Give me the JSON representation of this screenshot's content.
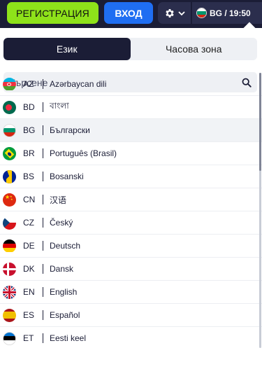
{
  "header": {
    "register_label": "РЕГИСТРАЦИЯ",
    "login_label": "ВХОД",
    "settings_icon": "gear-icon",
    "locale_label": "BG / 19:50"
  },
  "tabs": [
    {
      "label": "Език",
      "active": true
    },
    {
      "label": "Часова зона",
      "active": false
    }
  ],
  "search": {
    "placeholder": "Търсене",
    "icon": "search-icon"
  },
  "languages": [
    {
      "code": "AZ",
      "name": "Azərbaycan dili",
      "flag": "azerbaijan"
    },
    {
      "code": "BD",
      "name": "বাংলা",
      "flag": "bangladesh"
    },
    {
      "code": "BG",
      "name": "Български",
      "flag": "bulgaria",
      "selected": true
    },
    {
      "code": "BR",
      "name": "Português (Brasil)",
      "flag": "brazil"
    },
    {
      "code": "BS",
      "name": "Bosanski",
      "flag": "bosnia"
    },
    {
      "code": "CN",
      "name": "汉语",
      "flag": "china"
    },
    {
      "code": "CZ",
      "name": "Český",
      "flag": "czech"
    },
    {
      "code": "DE",
      "name": "Deutsch",
      "flag": "germany"
    },
    {
      "code": "DK",
      "name": "Dansk",
      "flag": "denmark"
    },
    {
      "code": "EN",
      "name": "English",
      "flag": "uk"
    },
    {
      "code": "ES",
      "name": "Español",
      "flag": "spain"
    },
    {
      "code": "ET",
      "name": "Eesti keel",
      "flag": "estonia"
    }
  ],
  "colors": {
    "accent_green": "#8ee21a",
    "accent_blue": "#1f6ef2",
    "dark": "#1b1d36"
  }
}
